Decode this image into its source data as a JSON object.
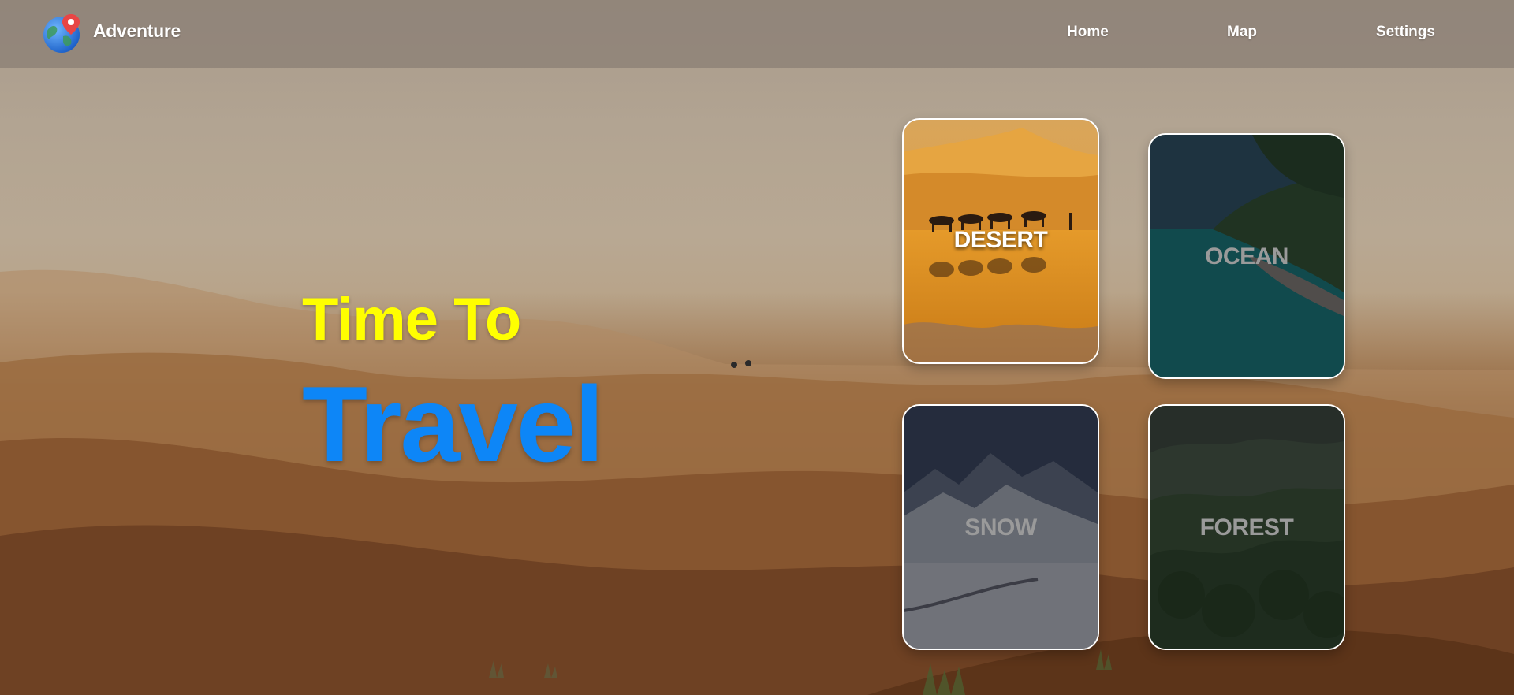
{
  "navbar": {
    "brand": "Adventure",
    "logo_icon": "globe-pin-icon",
    "links": [
      "Home",
      "Map",
      "Settings"
    ]
  },
  "hero": {
    "line1": "Time To",
    "line2": "Travel"
  },
  "cards": [
    {
      "label": "DESERT",
      "active": true
    },
    {
      "label": "OCEAN",
      "active": false
    },
    {
      "label": "SNOW",
      "active": false
    },
    {
      "label": "FOREST",
      "active": false
    }
  ],
  "colors": {
    "hero_line1": "#ffff00",
    "hero_line2": "#0d86f7",
    "nav_text": "#ffffff",
    "card_border": "#ffffff"
  }
}
